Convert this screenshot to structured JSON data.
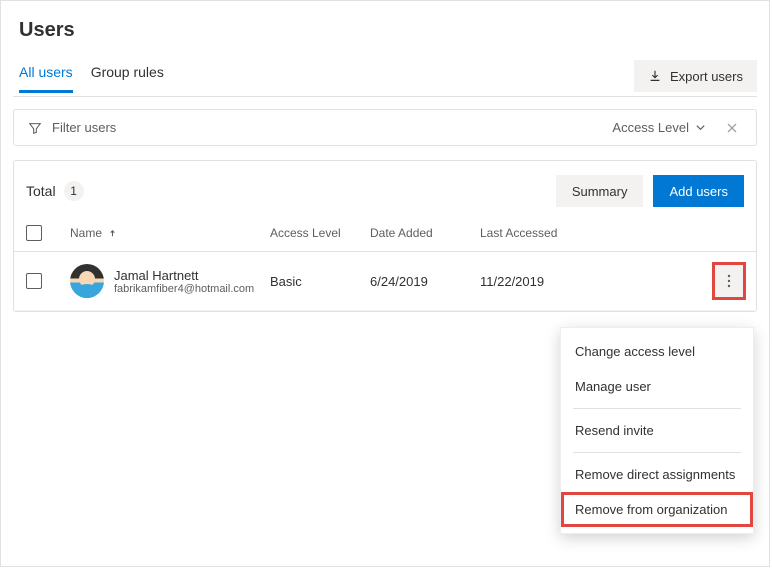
{
  "page_title": "Users",
  "tabs": {
    "all_users": "All users",
    "group_rules": "Group rules"
  },
  "export_label": "Export users",
  "filter": {
    "placeholder": "Filter users",
    "access_level_label": "Access Level"
  },
  "summary": {
    "total_label": "Total",
    "total_count": "1",
    "summary_btn": "Summary",
    "add_btn": "Add users"
  },
  "columns": {
    "name": "Name",
    "access_level": "Access Level",
    "date_added": "Date Added",
    "last_accessed": "Last Accessed"
  },
  "rows": [
    {
      "name": "Jamal Hartnett",
      "email": "fabrikamfiber4@hotmail.com",
      "access_level": "Basic",
      "date_added": "6/24/2019",
      "last_accessed": "11/22/2019"
    }
  ],
  "menu": {
    "change_access": "Change access level",
    "manage_user": "Manage user",
    "resend_invite": "Resend invite",
    "remove_direct": "Remove direct assignments",
    "remove_org": "Remove from organization"
  }
}
